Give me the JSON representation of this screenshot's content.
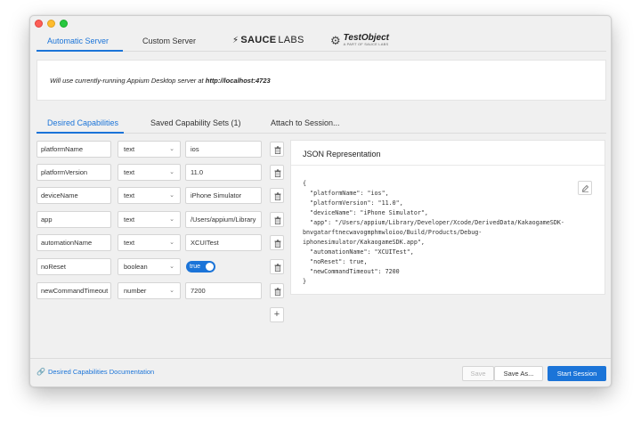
{
  "server_tabs": {
    "automatic": "Automatic Server",
    "custom": "Custom Server",
    "saucelabs_bold": "SAUCE",
    "saucelabs_light": "LABS",
    "testobject_name": "TestObject",
    "testobject_sub": "A PART OF SAUCE LABS"
  },
  "info": {
    "prefix": "Will use currently-running Appium Desktop server at ",
    "url": "http://localhost:4723"
  },
  "cap_tabs": {
    "desired": "Desired Capabilities",
    "saved": "Saved Capability Sets (1)",
    "attach": "Attach to Session..."
  },
  "capabilities": [
    {
      "name": "platformName",
      "type": "text",
      "value": "ios"
    },
    {
      "name": "platformVersion",
      "type": "text",
      "value": "11.0"
    },
    {
      "name": "deviceName",
      "type": "text",
      "value": "iPhone Simulator"
    },
    {
      "name": "app",
      "type": "text",
      "value": "/Users/appium/Library"
    },
    {
      "name": "automationName",
      "type": "text",
      "value": "XCUITest"
    },
    {
      "name": "noReset",
      "type": "boolean",
      "value": "true"
    },
    {
      "name": "newCommandTimeout",
      "type": "number",
      "value": "7200"
    }
  ],
  "json_panel": {
    "title": "JSON Representation",
    "code": "{\n  \"platformName\": \"ios\",\n  \"platformVersion\": \"11.0\",\n  \"deviceName\": \"iPhone Simulator\",\n  \"app\": \"/Users/appium/Library/Developer/Xcode/DerivedData/KakaogameSDK-\nbnvgatarftnecwavogmphmwloioo/Build/Products/Debug-\niphonesimulator/KakaogameSDK.app\",\n  \"automationName\": \"XCUITest\",\n  \"noReset\": true,\n  \"newCommandTimeout\": 7200\n}"
  },
  "footer": {
    "doc_link": "Desired Capabilities Documentation",
    "save": "Save",
    "save_as": "Save As...",
    "start": "Start Session"
  },
  "colors": {
    "accent": "#1b74d8",
    "window_bg": "#f0f0f0"
  }
}
